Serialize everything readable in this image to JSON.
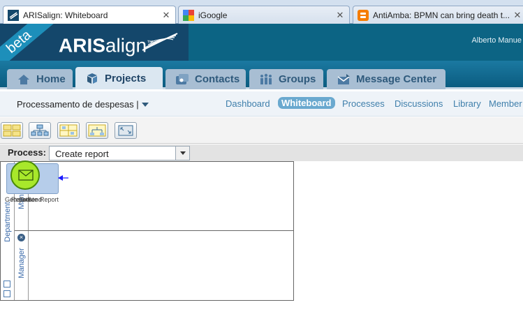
{
  "browser_tabs": [
    {
      "title": "ARISalign: Whiteboard",
      "close": "✕",
      "active": true
    },
    {
      "title": "iGoogle",
      "close": "✕",
      "active": false
    },
    {
      "title": "AntiAmba: BPMN can bring death t...",
      "close": "✕",
      "active": false
    }
  ],
  "header": {
    "beta": "beta",
    "logo_bold": "ARIS",
    "logo_light": "align",
    "logo_tm": "™",
    "user": "Alberto Manue"
  },
  "main_nav": [
    {
      "label": "Home",
      "icon": "home-icon"
    },
    {
      "label": "Projects",
      "icon": "projects-icon",
      "active": true
    },
    {
      "label": "Contacts",
      "icon": "contacts-icon"
    },
    {
      "label": "Groups",
      "icon": "groups-icon"
    },
    {
      "label": "Message Center",
      "icon": "message-center-icon"
    }
  ],
  "sub_nav": {
    "project": "Processamento de despesas |",
    "links": [
      "Dashboard",
      "Whiteboard",
      "Processes",
      "Discussions",
      "Library",
      "Member"
    ],
    "active": "Whiteboard"
  },
  "toolbar": {
    "buttons": [
      "layout-grid-icon",
      "org-chart-icon",
      "swimlane-icon",
      "hierarchy-icon",
      "fit-screen-icon"
    ]
  },
  "process": {
    "label": "Process:",
    "selected": "Create report"
  },
  "diagram": {
    "pool": "Department",
    "lanes": [
      "Manager",
      "Manager"
    ],
    "overlapping_labels": [
      "Generate",
      "Report",
      "Create",
      "Send",
      "Report"
    ],
    "colors": {
      "event_fill": "#a8e82b",
      "task_fill": "#b6cdea",
      "lane_label": "#3868a8"
    }
  }
}
